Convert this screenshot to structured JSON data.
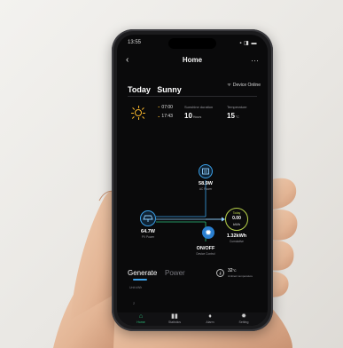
{
  "status_bar": {
    "time": "13:55",
    "icons": "▪ ◨ ▬"
  },
  "nav": {
    "back": "‹",
    "title": "Home",
    "more": "···"
  },
  "today": {
    "label": "Today",
    "weather": "Sunny",
    "device_status": "Device Online",
    "wifi_icon": "wifi-icon"
  },
  "weather": {
    "sunrise": "07:00",
    "sunset": "17:43",
    "duration_label": "Sunshine duration",
    "duration_value": "10",
    "duration_unit": "Hours",
    "temperature_label": "Temperature",
    "temperature_value": "15",
    "temperature_unit": "°C"
  },
  "flow": {
    "ac": {
      "value": "58.9W",
      "label": "AC Power"
    },
    "pv": {
      "value": "64.7W",
      "label": "PV Power"
    },
    "today": {
      "label": "Today",
      "value": "0.00",
      "unit": "kWh"
    },
    "cumulative": {
      "value": "1.32kWh",
      "label": "Cumulative"
    },
    "device": {
      "value": "ON/OFF",
      "label": "Device Control"
    }
  },
  "tabs": {
    "generate": "Generate",
    "power": "Power"
  },
  "ambient": {
    "value": "32",
    "unit": "°C",
    "label": "Ambient temperature"
  },
  "chart": {
    "unit_label": "Unit:kWh",
    "tick": "2"
  },
  "bottom_nav": [
    {
      "label": "Home",
      "icon": "home-icon",
      "glyph": "■"
    },
    {
      "label": "Statistics",
      "icon": "bar-chart-icon",
      "glyph": "▮"
    },
    {
      "label": "Alarm",
      "icon": "bell-icon",
      "glyph": "▲"
    },
    {
      "label": "Setting",
      "icon": "gear-icon",
      "glyph": "✹"
    }
  ],
  "colors": {
    "accent_blue": "#3aa0e8",
    "accent_green": "#2ec27e",
    "sun": "#f4b32b"
  }
}
